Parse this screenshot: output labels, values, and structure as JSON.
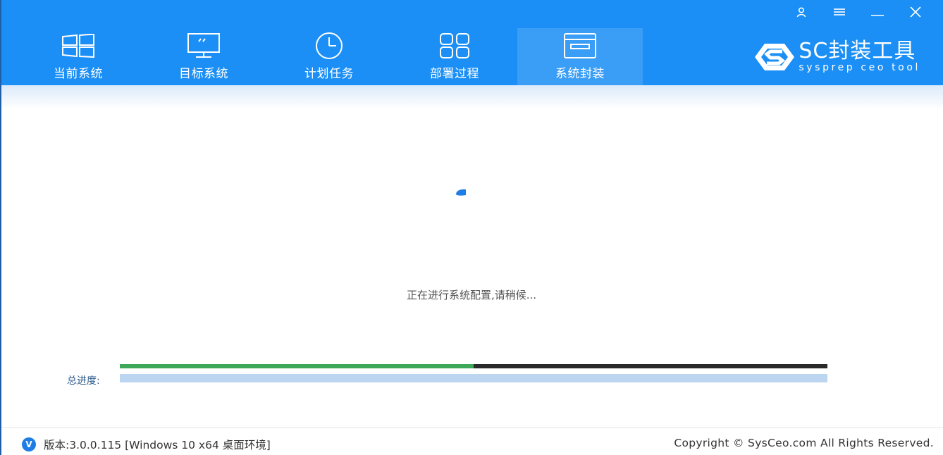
{
  "window": {
    "controls": [
      "user-icon",
      "menu-icon",
      "minimize-icon",
      "close-icon"
    ]
  },
  "tabs": [
    {
      "label": "当前系统",
      "icon": "windows-icon",
      "active": false
    },
    {
      "label": "目标系统",
      "icon": "monitor-icon",
      "active": false
    },
    {
      "label": "计划任务",
      "icon": "clock-icon",
      "active": false
    },
    {
      "label": "部署过程",
      "icon": "grid-icon",
      "active": false
    },
    {
      "label": "系统封装",
      "icon": "package-icon",
      "active": true
    }
  ],
  "brand": {
    "title": "SC封装工具",
    "subtitle": "sysprep ceo tool"
  },
  "main": {
    "status": "正在进行系统配置,请稍候...",
    "current_progress": 0.5,
    "total_label": "总进度:",
    "total_progress": 0
  },
  "footer": {
    "badge": "V",
    "version": "版本:3.0.0.115 [Windows 10 x64 桌面环境]",
    "copyright": "Copyright © SysCeo.com All Rights Reserved."
  },
  "colors": {
    "header": "#1b8ff5",
    "active_tab": "#3a9df6",
    "progress_green": "#3ea85a",
    "progress_track": "#2a2a2a",
    "total_track": "#bcd6f1",
    "badge": "#1e7ee6"
  }
}
